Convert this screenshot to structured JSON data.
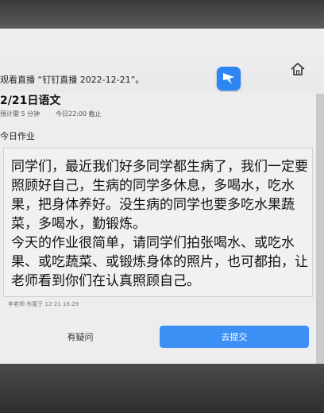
{
  "banner": {
    "text": "观看直播 “钉钉直播 2022-12-21”。"
  },
  "assignment": {
    "title": "2/21日语文",
    "time_estimate": "预计需 5 分钟",
    "deadline": "今日22:00 截止",
    "section": "今日作业",
    "paragraphs": [
      "同学们，最近我们好多同学都生病了，我们一定要照顾好自己，生病的同学多休息，多喝水，吃水果，把身体养好。没生病的同学也要多吃水果蔬菜，多喝水，勤锻炼。",
      "今天的作业很简单，请同学们拍张喝水、或吃水果、或吃蔬菜、或锻炼身体的照片，也可都拍，让老师看到你们在认真照顾自己。"
    ],
    "footer": "李老师 布置于 12-21 16:29"
  },
  "actions": {
    "ask_label": "有疑问",
    "submit_label": "去提交"
  },
  "colors": {
    "accent": "#3b8ff5",
    "logo": "#2b86f2"
  }
}
